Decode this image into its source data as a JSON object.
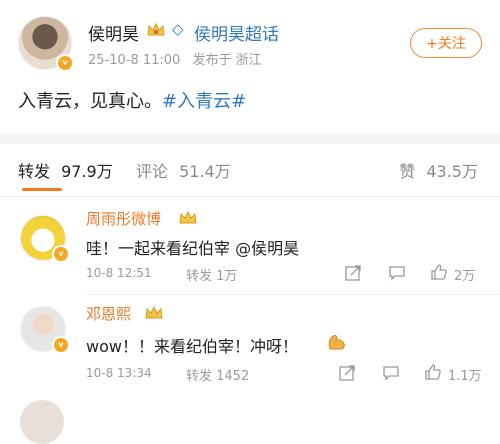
{
  "post": {
    "author": "侯明昊",
    "topic": "侯明昊超话",
    "date": "25-10-8 11:00",
    "published_from": "发布于 浙江",
    "follow_label": "+关注",
    "text_main": "入青云，见真心。",
    "hashtag": "#入青云#"
  },
  "stats": {
    "repost_label": "转发",
    "repost_count": "97.9万",
    "comment_label": "评论",
    "comment_count": "51.4万",
    "like_label": "赞",
    "like_count": "43.5万"
  },
  "comments": [
    {
      "name": "周雨彤微博",
      "text": "哇！一起来看纪伯宰 @侯明昊",
      "time": "10-8 12:51",
      "repost": "转发 1万",
      "likes": "2万"
    },
    {
      "name": "邓恩熙",
      "text": "wow！！来看纪伯宰！冲呀！",
      "time": "10-8 13:34",
      "repost": "转发 1452",
      "likes": "1.1万"
    }
  ],
  "colors": {
    "accent": "#f27a1a",
    "link": "#2f78c4",
    "muted": "#9a9a9a"
  }
}
